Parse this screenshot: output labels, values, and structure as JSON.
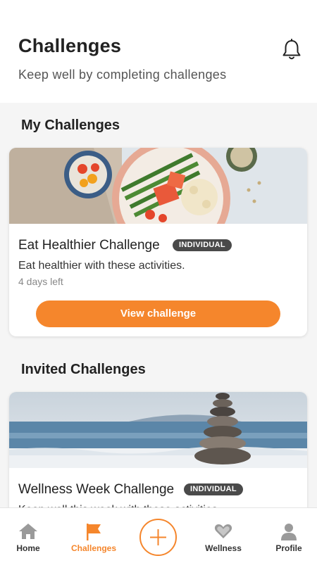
{
  "header": {
    "title": "Challenges",
    "subtitle": "Keep well by completing challenges"
  },
  "my_challenges": {
    "section_title": "My Challenges",
    "card": {
      "name": "Eat Healthier Challenge",
      "badge": "INDIVIDUAL",
      "description": "Eat healthier with these activities.",
      "time_left": "4 days left",
      "button_label": "View challenge"
    }
  },
  "invited_challenges": {
    "section_title": "Invited Challenges",
    "card": {
      "name": "Wellness Week Challenge",
      "badge": "INDIVIDUAL",
      "description": "Keep well this week with these activities."
    }
  },
  "tabbar": {
    "items": [
      {
        "label": "Home",
        "icon": "home-icon"
      },
      {
        "label": "Challenges",
        "icon": "flag-icon",
        "active": true
      },
      {
        "label": "",
        "icon": "plus-icon"
      },
      {
        "label": "Wellness",
        "icon": "heart-icon"
      },
      {
        "label": "Profile",
        "icon": "profile-icon"
      }
    ]
  },
  "colors": {
    "accent": "#f5862c",
    "badge": "#4a4a4a",
    "background": "#f5f5f5"
  }
}
